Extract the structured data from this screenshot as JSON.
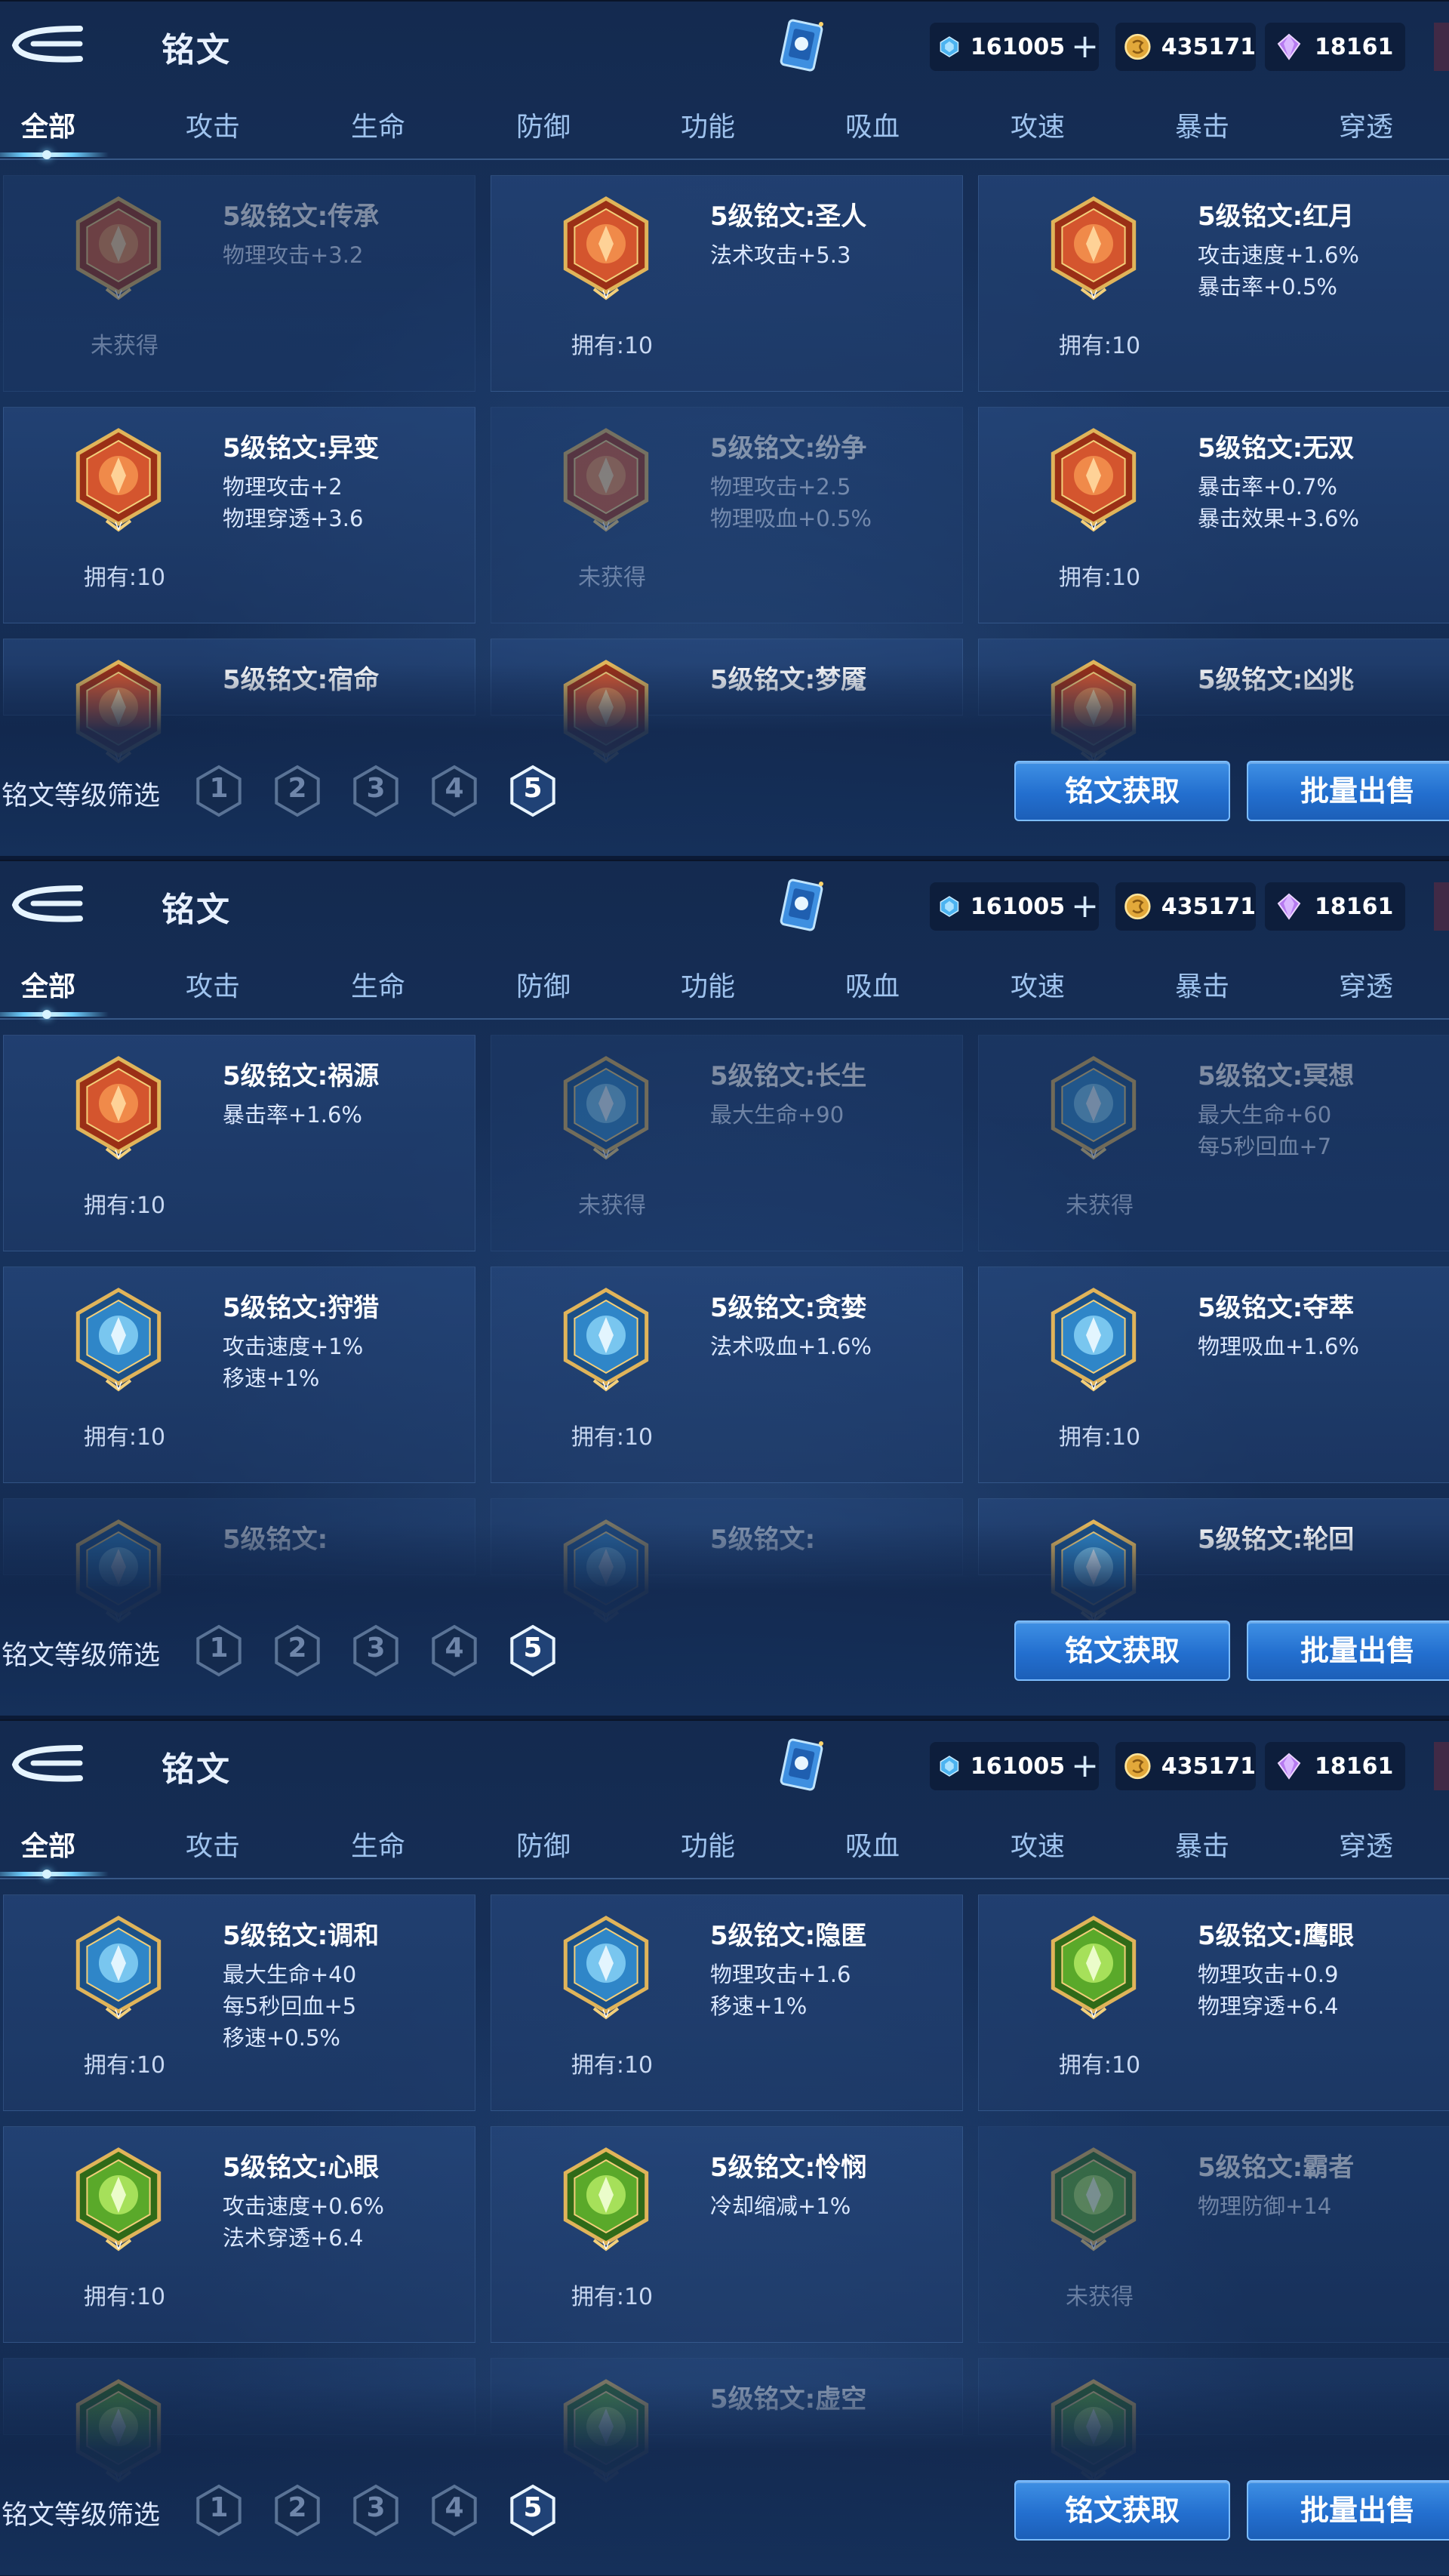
{
  "header": {
    "title": "铭文",
    "currency": [
      {
        "icon": "diamond-coupon-icon",
        "value": "161005",
        "plus": "+"
      },
      {
        "icon": "gold-coin-icon",
        "value": "435171"
      },
      {
        "icon": "purple-crystal-icon",
        "value": "18161"
      }
    ]
  },
  "tabs": [
    "全部",
    "攻击",
    "生命",
    "防御",
    "功能",
    "吸血",
    "攻速",
    "暴击",
    "穿透"
  ],
  "active_tab": "全部",
  "filter": {
    "label": "铭文等级筛选",
    "levels": [
      "1",
      "2",
      "3",
      "4",
      "5"
    ],
    "selected": "5"
  },
  "buttons": {
    "get": "铭文获取",
    "sell": "批量出售"
  },
  "colors": {
    "red": "#c8442a",
    "blue": "#2a8fd0",
    "green": "#62b530",
    "gold": "#e0b45a"
  },
  "panels": [
    {
      "cards": [
        {
          "name": "5级铭文:传承",
          "stats": [
            "物理攻击+3.2"
          ],
          "owned": "未获得",
          "color": "red",
          "dim": true
        },
        {
          "name": "5级铭文:圣人",
          "stats": [
            "法术攻击+5.3"
          ],
          "owned": "拥有:10",
          "color": "red",
          "dim": false
        },
        {
          "name": "5级铭文:红月",
          "stats": [
            "攻击速度+1.6%",
            "暴击率+0.5%"
          ],
          "owned": "拥有:10",
          "color": "red",
          "dim": false
        },
        {
          "name": "5级铭文:异变",
          "stats": [
            "物理攻击+2",
            "物理穿透+3.6"
          ],
          "owned": "拥有:10",
          "color": "red",
          "dim": false
        },
        {
          "name": "5级铭文:纷争",
          "stats": [
            "物理攻击+2.5",
            "物理吸血+0.5%"
          ],
          "owned": "未获得",
          "color": "red",
          "dim": true
        },
        {
          "name": "5级铭文:无双",
          "stats": [
            "暴击率+0.7%",
            "暴击效果+3.6%"
          ],
          "owned": "拥有:10",
          "color": "red",
          "dim": false
        },
        {
          "name": "5级铭文:宿命",
          "stats": [],
          "owned": "",
          "color": "red",
          "dim": false
        },
        {
          "name": "5级铭文:梦魇",
          "stats": [],
          "owned": "",
          "color": "red",
          "dim": false
        },
        {
          "name": "5级铭文:凶兆",
          "stats": [],
          "owned": "",
          "color": "red",
          "dim": false
        }
      ]
    },
    {
      "cards": [
        {
          "name": "5级铭文:祸源",
          "stats": [
            "暴击率+1.6%"
          ],
          "owned": "拥有:10",
          "color": "red",
          "dim": false
        },
        {
          "name": "5级铭文:长生",
          "stats": [
            "最大生命+90"
          ],
          "owned": "未获得",
          "color": "blue",
          "dim": true
        },
        {
          "name": "5级铭文:冥想",
          "stats": [
            "最大生命+60",
            "每5秒回血+7"
          ],
          "owned": "未获得",
          "color": "blue",
          "dim": true
        },
        {
          "name": "5级铭文:狩猎",
          "stats": [
            "攻击速度+1%",
            "移速+1%"
          ],
          "owned": "拥有:10",
          "color": "blue",
          "dim": false
        },
        {
          "name": "5级铭文:贪婪",
          "stats": [
            "法术吸血+1.6%"
          ],
          "owned": "拥有:10",
          "color": "blue",
          "dim": false
        },
        {
          "name": "5级铭文:夺萃",
          "stats": [
            "物理吸血+1.6%"
          ],
          "owned": "拥有:10",
          "color": "blue",
          "dim": false
        },
        {
          "name": "5级铭文:",
          "stats": [],
          "owned": "",
          "color": "blue",
          "dim": true
        },
        {
          "name": "5级铭文:",
          "stats": [],
          "owned": "",
          "color": "blue",
          "dim": true
        },
        {
          "name": "5级铭文:轮回",
          "stats": [],
          "owned": "",
          "color": "blue",
          "dim": false
        }
      ]
    },
    {
      "cards": [
        {
          "name": "5级铭文:调和",
          "stats": [
            "最大生命+40",
            "每5秒回血+5",
            "移速+0.5%"
          ],
          "owned": "拥有:10",
          "color": "blue",
          "dim": false
        },
        {
          "name": "5级铭文:隐匿",
          "stats": [
            "物理攻击+1.6",
            "移速+1%"
          ],
          "owned": "拥有:10",
          "color": "blue",
          "dim": false
        },
        {
          "name": "5级铭文:鹰眼",
          "stats": [
            "物理攻击+0.9",
            "物理穿透+6.4"
          ],
          "owned": "拥有:10",
          "color": "green",
          "dim": false
        },
        {
          "name": "5级铭文:心眼",
          "stats": [
            "攻击速度+0.6%",
            "法术穿透+6.4"
          ],
          "owned": "拥有:10",
          "color": "green",
          "dim": false
        },
        {
          "name": "5级铭文:怜悯",
          "stats": [
            "冷却缩减+1%"
          ],
          "owned": "拥有:10",
          "color": "green",
          "dim": false
        },
        {
          "name": "5级铭文:霸者",
          "stats": [
            "物理防御+14"
          ],
          "owned": "未获得",
          "color": "green",
          "dim": true
        },
        {
          "name": "",
          "stats": [],
          "owned": "",
          "color": "green",
          "dim": true
        },
        {
          "name": "5级铭文:虚空",
          "stats": [],
          "owned": "",
          "color": "green",
          "dim": true
        },
        {
          "name": "",
          "stats": [],
          "owned": "",
          "color": "green",
          "dim": true
        }
      ]
    }
  ]
}
